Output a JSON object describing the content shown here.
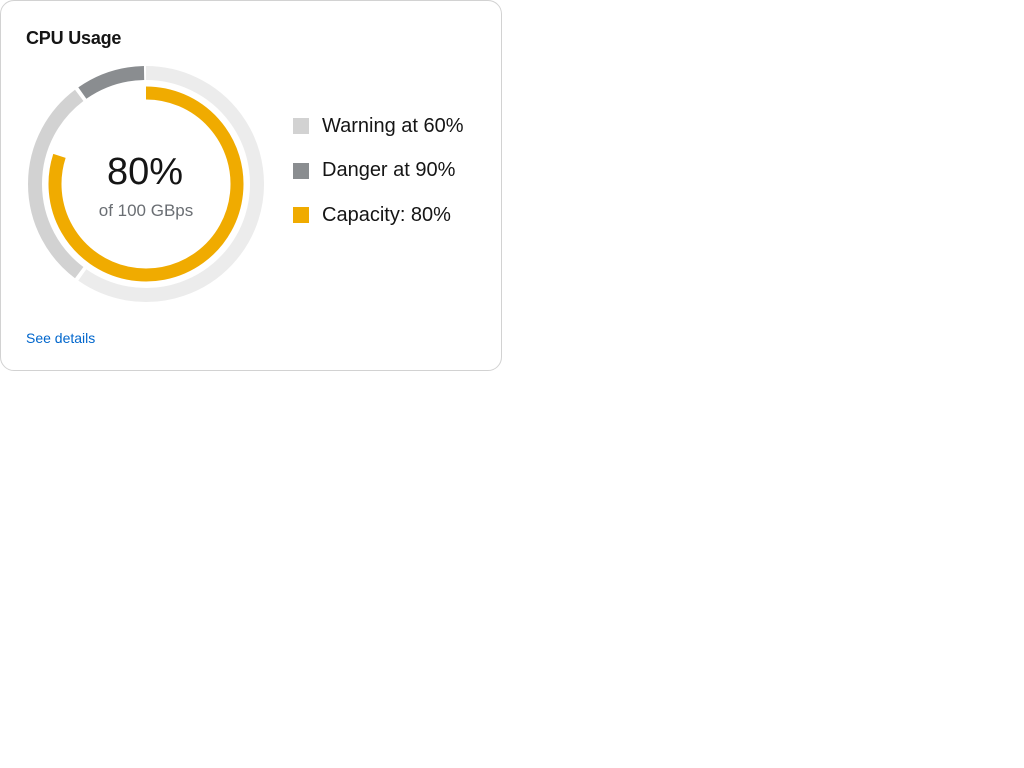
{
  "card": {
    "title": "CPU Usage",
    "footer_link": "See details"
  },
  "gauge": {
    "value_label": "80%",
    "sub_label": "of 100 GBps",
    "value_percent": 80,
    "warning_percent": 60,
    "danger_percent": 90
  },
  "colors": {
    "capacity": "#f0ab00",
    "warning": "#d2d2d2",
    "danger": "#8a8d90",
    "track": "#ececec",
    "link": "#0066cc"
  },
  "legend": [
    {
      "label": "Warning at 60%",
      "color": "#d2d2d2"
    },
    {
      "label": "Danger at 90%",
      "color": "#8a8d90"
    },
    {
      "label": "Capacity: 80%",
      "color": "#f0ab00"
    }
  ]
}
